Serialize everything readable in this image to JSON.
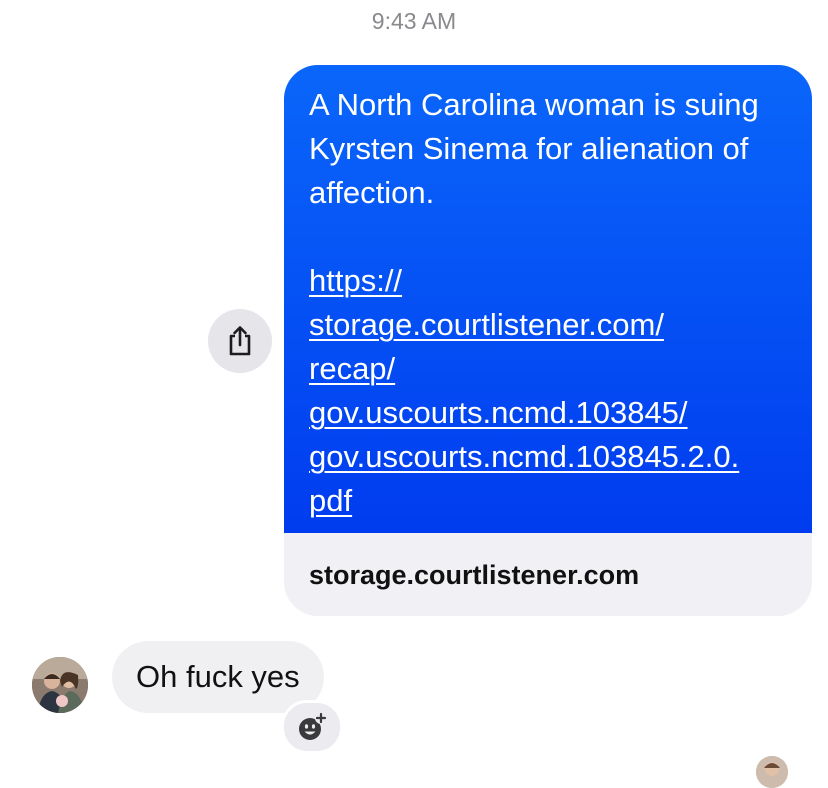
{
  "header": {
    "timestamp": "9:43 AM"
  },
  "sent_message": {
    "text": "A North Carolina woman is suing Kyrsten Sinema for alienation of affection.",
    "link_lines": [
      "https://",
      "storage.courtlistener.com/",
      "recap/",
      "gov.uscourts.ncmd.103845/",
      "gov.uscourts.ncmd.103845.2.0.",
      "pdf"
    ],
    "link_preview_domain": "storage.courtlistener.com",
    "bubble_color": "#0a66fa"
  },
  "received_message": {
    "text": "Oh fuck yes",
    "bubble_color": "#f0f0f3"
  },
  "icons": {
    "share": "share-icon",
    "add_reaction": "add-reaction-icon",
    "sender_avatar": "avatar",
    "read_receipt_avatar": "avatar"
  }
}
